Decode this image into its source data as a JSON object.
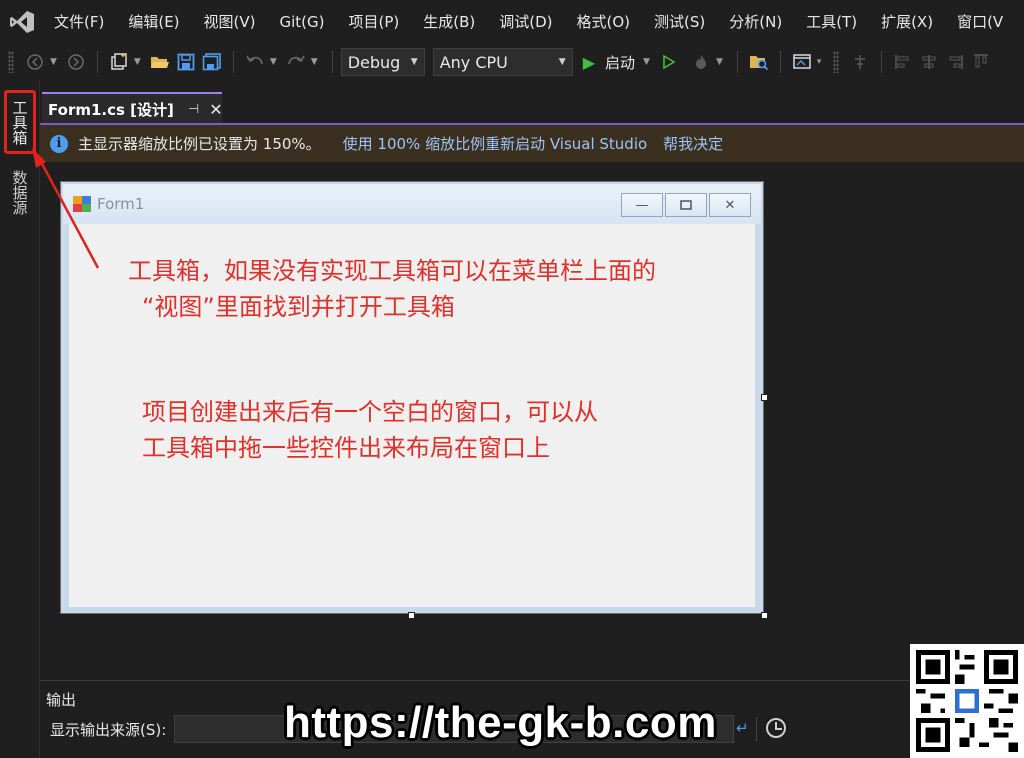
{
  "menubar": {
    "items": [
      "文件(F)",
      "编辑(E)",
      "视图(V)",
      "Git(G)",
      "项目(P)",
      "生成(B)",
      "调试(D)",
      "格式(O)",
      "测试(S)",
      "分析(N)",
      "工具(T)",
      "扩展(X)",
      "窗口(V"
    ]
  },
  "toolbar": {
    "config": "Debug",
    "platform": "Any CPU",
    "start_label": "启动"
  },
  "side_tabs": {
    "toolbox": "工具箱",
    "datasource": "数据源"
  },
  "document_tab": {
    "title": "Form1.cs [设计]"
  },
  "infobar": {
    "message": "主显示器缩放比例已设置为 150%。",
    "restart_link": "使用 100% 缩放比例重新启动 Visual Studio",
    "decide_link": "帮我决定"
  },
  "form": {
    "title": "Form1"
  },
  "annotations": {
    "toolbox_line1": "工具箱，如果没有实现工具箱可以在菜单栏上面的",
    "toolbox_line2": "“视图”里面找到并打开工具箱",
    "window_line1": "项目创建出来后有一个空白的窗口，可以从",
    "window_line2": "工具箱中拖一些控件出来布局在窗口上"
  },
  "output": {
    "title": "输出",
    "source_label": "显示输出来源(S):"
  },
  "watermark": "https://the-gk-b.com",
  "colors": {
    "accent": "#a37cf0",
    "annotation": "#e0302a",
    "info_bar": "#3b3020",
    "link": "#9cc4f5"
  }
}
